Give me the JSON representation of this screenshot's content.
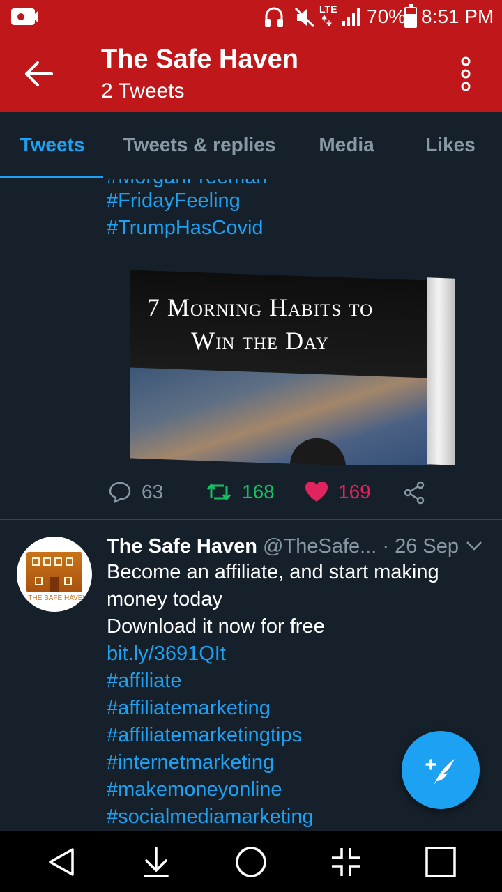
{
  "status_bar": {
    "lte": "LTE",
    "battery": "70%",
    "time": "8:51 PM",
    "battery_level": 0.7
  },
  "app_bar": {
    "title": "The Safe Haven",
    "subtitle": "2 Tweets"
  },
  "tabs": [
    {
      "label": "Tweets",
      "active": true
    },
    {
      "label": "Tweets & replies",
      "active": false
    },
    {
      "label": "Media",
      "active": false
    },
    {
      "label": "Likes",
      "active": false
    }
  ],
  "tweet1": {
    "partial_tag": "#MorganFreeman",
    "hashtags": [
      "#FridayFeeling",
      "#TrumpHasCovid"
    ],
    "image_title_line1": "7 Morning Habits to",
    "image_title_line2": "Win the Day",
    "replies": "63",
    "retweets": "168",
    "likes": "169"
  },
  "tweet2": {
    "name": "The Safe Haven",
    "handle": "@TheSafe...",
    "dot": "·",
    "date": "26 Sep",
    "avatar_text": "THE SAFE HAVEN",
    "text_line1": "Become an affiliate, and start making",
    "text_line2": "money today",
    "text_line3": "Download it now for free",
    "link": "bit.ly/3691QIt",
    "hashtags": [
      "#affiliate",
      "#affiliatemarketing",
      "#affiliatemarketingtips",
      "#internetmarketing",
      "#makemoneyonline",
      "#socialmediamarketing"
    ]
  },
  "colors": {
    "app_bar": "#c0181a",
    "background": "#15202b",
    "accent": "#1da1f2",
    "retweet": "#17bf63",
    "like": "#e0245e",
    "muted": "#8899a6"
  },
  "icons": [
    "video-camera-icon",
    "headphones-icon",
    "mute-icon",
    "signal-icon",
    "battery-icon",
    "back-arrow-icon",
    "more-vertical-icon",
    "reply-icon",
    "retweet-icon",
    "heart-icon",
    "share-icon",
    "chevron-down-icon",
    "compose-tweet-icon",
    "nav-back-icon",
    "nav-download-icon",
    "nav-home-icon",
    "nav-fullscreen-icon",
    "nav-recents-icon"
  ]
}
